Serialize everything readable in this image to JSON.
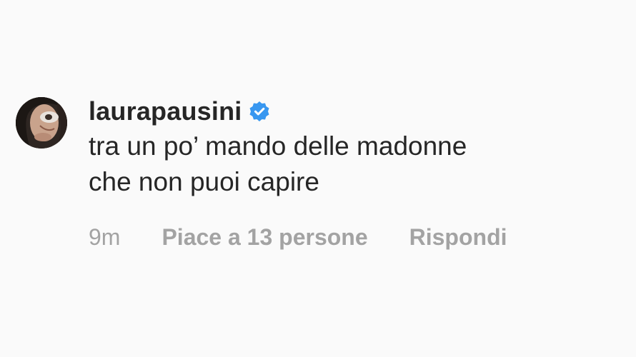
{
  "comment": {
    "username": "laurapausini",
    "verified_icon": "verified-badge-icon",
    "text": "tra un po’ mando delle madonne\nche non puoi capire",
    "time": "9m",
    "likes": "Piace a 13 persone",
    "reply": "Rispondi"
  },
  "colors": {
    "background": "#fafafa",
    "text": "#262626",
    "meta": "#a3a3a3",
    "verified": "#3897f0"
  }
}
